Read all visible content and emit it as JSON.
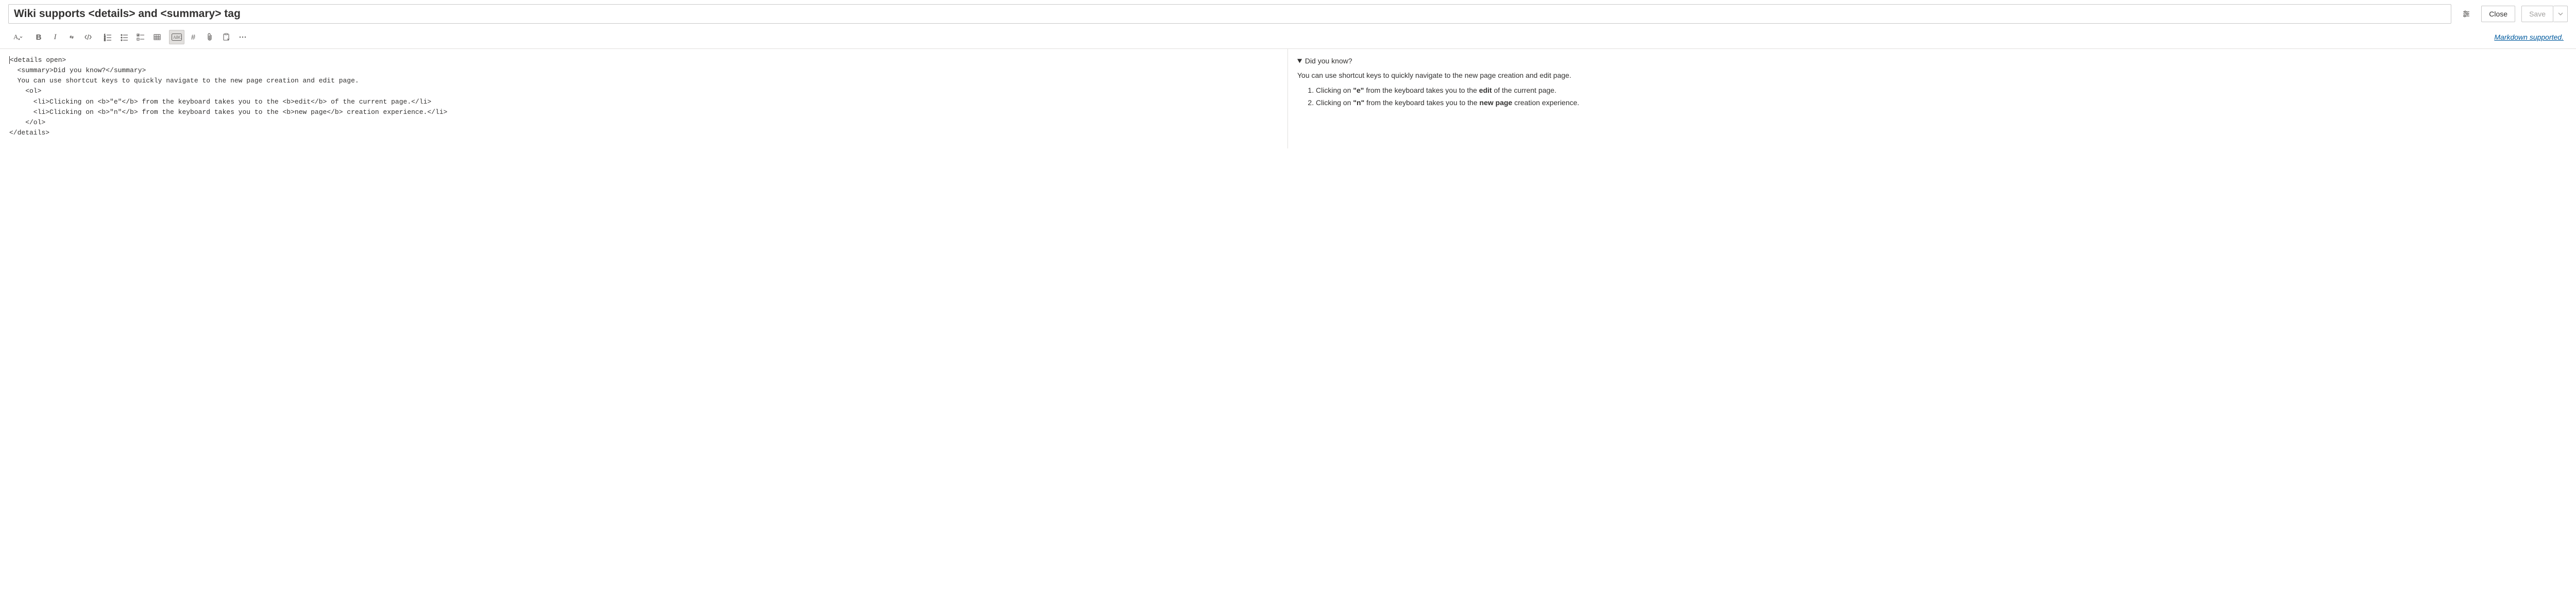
{
  "header": {
    "title_value": "Wiki supports <details> and <summary> tag",
    "close_label": "Close",
    "save_label": "Save"
  },
  "toolbar": {
    "markdown_link": "Markdown supported."
  },
  "editor": {
    "lines": [
      "<details open>",
      "  <summary>Did you know?</summary>",
      "  You can use shortcut keys to quickly navigate to the new page creation and edit page.",
      "    <ol>",
      "      <li>Clicking on <b>\"e\"</b> from the keyboard takes you to the <b>edit</b> of the current page.</li>",
      "      <li>Clicking on <b>\"n\"</b> from the keyboard takes you to the <b>new page</b> creation experience.</li>",
      "    </ol>",
      "</details>"
    ]
  },
  "preview": {
    "summary": "Did you know?",
    "intro": "You can use shortcut keys to quickly navigate to the new page creation and edit page.",
    "list": [
      {
        "pre": "Clicking on ",
        "bold1": "\"e\"",
        "mid": " from the keyboard takes you to the ",
        "bold2": "edit",
        "post": " of the current page."
      },
      {
        "pre": "Clicking on ",
        "bold1": "\"n\"",
        "mid": " from the keyboard takes you to the ",
        "bold2": "new page",
        "post": " creation experience."
      }
    ]
  }
}
